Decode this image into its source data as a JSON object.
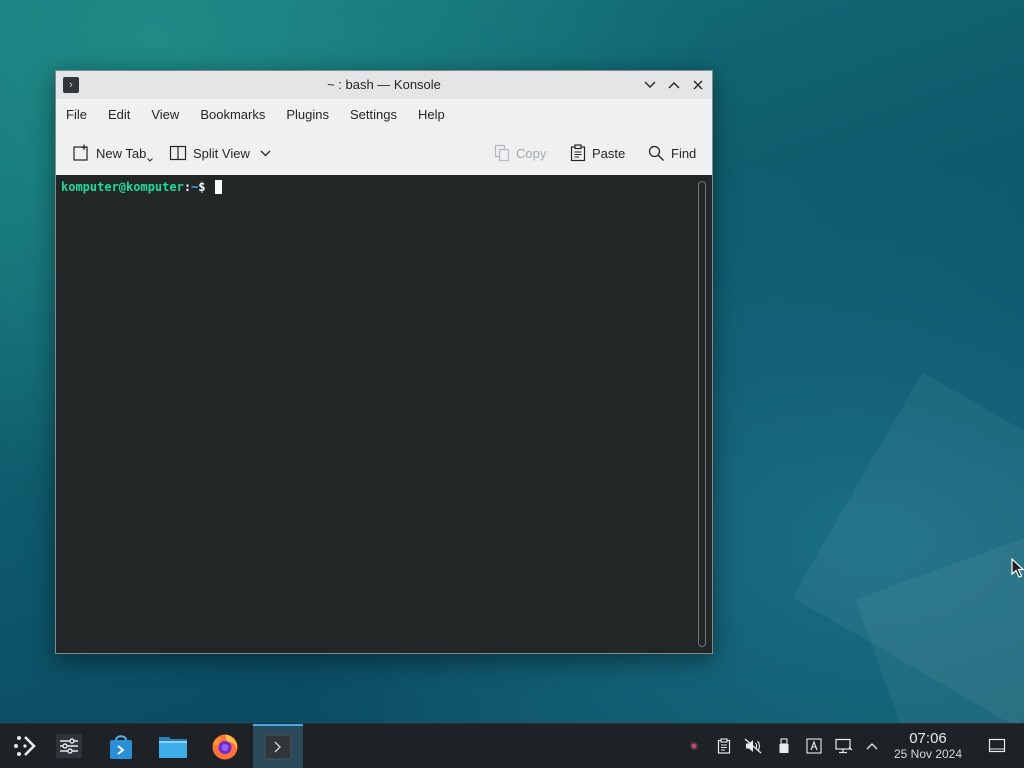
{
  "window": {
    "title": "~ : bash — Konsole",
    "menu": [
      "File",
      "Edit",
      "View",
      "Bookmarks",
      "Plugins",
      "Settings",
      "Help"
    ],
    "toolbar": {
      "new_tab": "New Tab",
      "split_view": "Split View",
      "copy": "Copy",
      "paste": "Paste",
      "find": "Find"
    }
  },
  "terminal": {
    "user_host": "komputer@komputer",
    "separator": ":",
    "path": "~",
    "symbol": "$ "
  },
  "taskbar": {
    "clock_time": "07:06",
    "clock_date": "25 Nov 2024"
  },
  "colors": {
    "prompt_green": "#1cdc9a",
    "accent_blue": "#3daee9",
    "terminal_bg": "#232627"
  }
}
